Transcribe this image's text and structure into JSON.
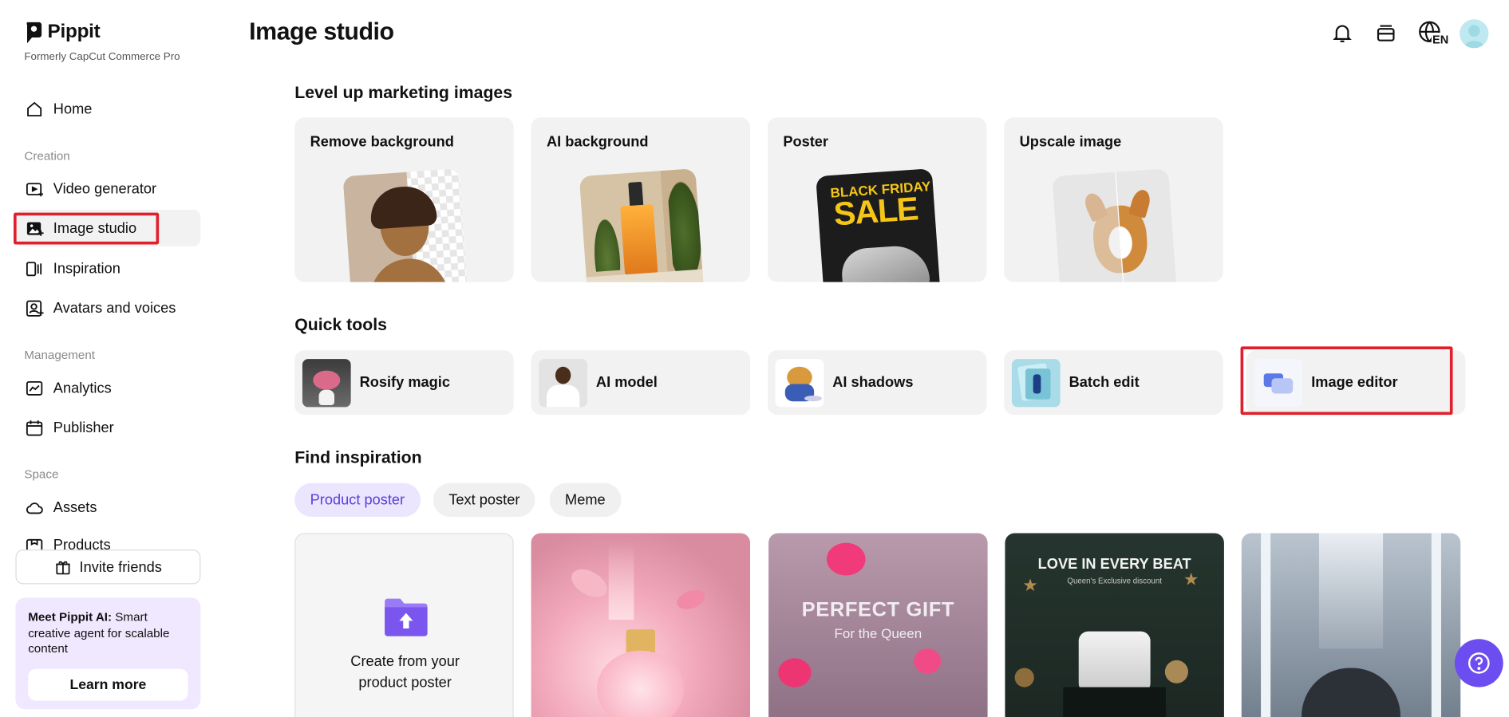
{
  "brand": {
    "name": "Pippit",
    "subtitle": "Formerly CapCut Commerce Pro"
  },
  "sidebar": {
    "home": "Home",
    "sections": {
      "creation": "Creation",
      "management": "Management",
      "space": "Space"
    },
    "items": {
      "video_generator": "Video generator",
      "image_studio": "Image studio",
      "inspiration": "Inspiration",
      "avatars": "Avatars and voices",
      "analytics": "Analytics",
      "publisher": "Publisher",
      "assets": "Assets",
      "products": "Products"
    },
    "invite": "Invite friends",
    "promo": {
      "bold": "Meet Pippit AI:",
      "text": " Smart creative agent for scalable content",
      "button": "Learn more"
    }
  },
  "header": {
    "title": "Image studio",
    "language": "EN"
  },
  "marketing": {
    "title": "Level up marketing images",
    "cards": [
      "Remove background",
      "AI background",
      "Poster",
      "Upscale image"
    ],
    "poster_line1": "BLACK FRIDAY",
    "poster_line2": "SALE"
  },
  "quick_tools": {
    "title": "Quick tools",
    "tools": [
      "Rosify magic",
      "AI model",
      "AI shadows",
      "Batch edit",
      "Image editor"
    ]
  },
  "inspiration": {
    "title": "Find inspiration",
    "chips": [
      "Product poster",
      "Text poster",
      "Meme"
    ],
    "create_text": "Create from your product poster",
    "card2_title": "PERFECT GIFT",
    "card2_sub": "For the Queen",
    "card3_title": "LOVE IN EVERY BEAT",
    "card3_sub": "Queen's Exclusive discount"
  },
  "icons": {
    "bell": "bell-icon",
    "wallet": "wallet-icon",
    "language": "globe-icon",
    "help": "question-icon"
  },
  "colors": {
    "accent": "#6c4df0",
    "highlight_border": "#e0202c",
    "chip_active_text": "#5b3fd9"
  }
}
